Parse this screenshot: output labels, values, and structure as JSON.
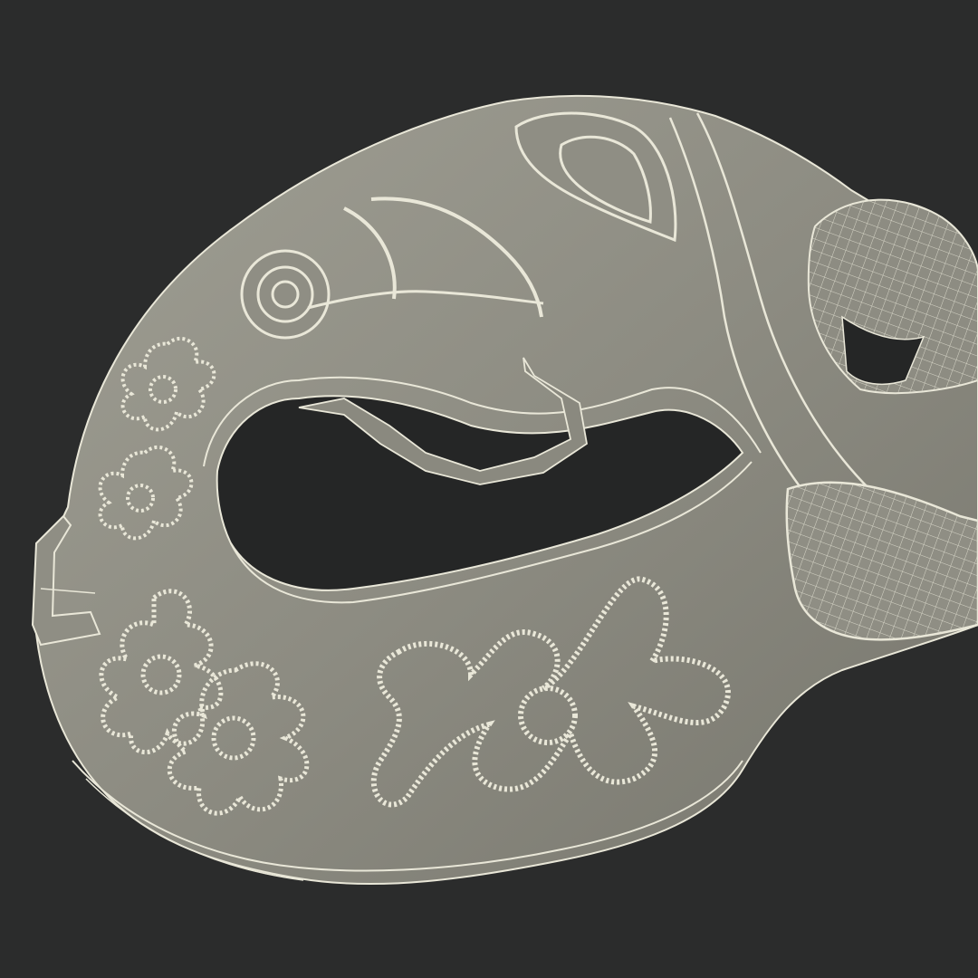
{
  "scene": {
    "subject": "mask-wireframe-render",
    "colors": {
      "background": "#2b2c2c",
      "surface": "#8d8c82",
      "surface_light": "#a3a297",
      "surface_dark": "#6f6e66",
      "wire": "#e9e7d8",
      "hole": "#252626"
    }
  }
}
